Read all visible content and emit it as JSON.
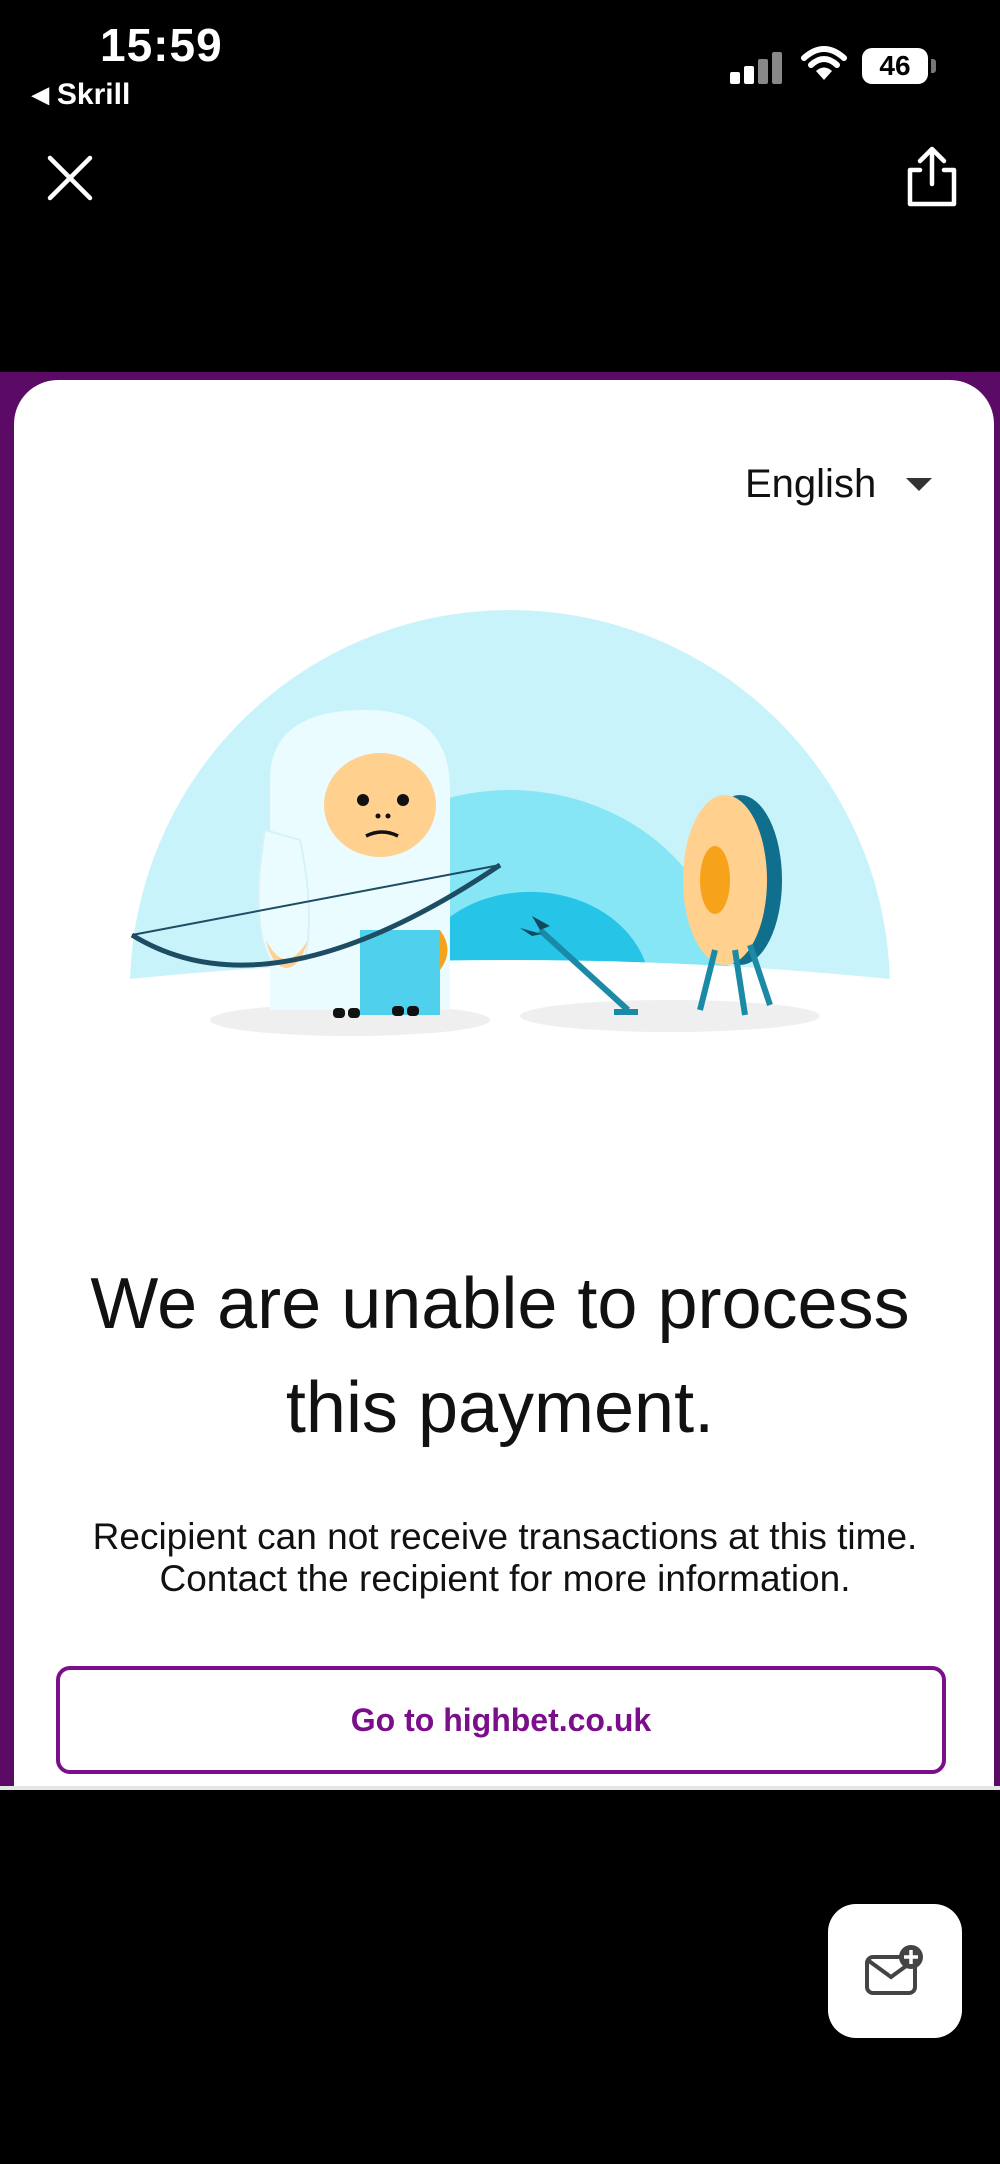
{
  "status_bar": {
    "time": "15:59",
    "back_app_label": "Skrill",
    "battery_level": "46"
  },
  "toolbar": {
    "close_icon": "close-icon",
    "share_icon": "share-icon"
  },
  "page": {
    "language_selected": "English",
    "headline": "We are unable to process this payment.",
    "message": "Recipient can not receive transactions at this time. Contact the recipient for more information.",
    "cta_label": "Go to highbet.co.uk"
  },
  "floating": {
    "chat_icon": "compose-message-icon"
  },
  "colors": {
    "brand_purple": "#7b0e8a",
    "frame_purple": "#5b0b66",
    "sky_light": "#c9f3fb",
    "sky_mid": "#7fe3f5",
    "sky_dark": "#22c3e6"
  }
}
